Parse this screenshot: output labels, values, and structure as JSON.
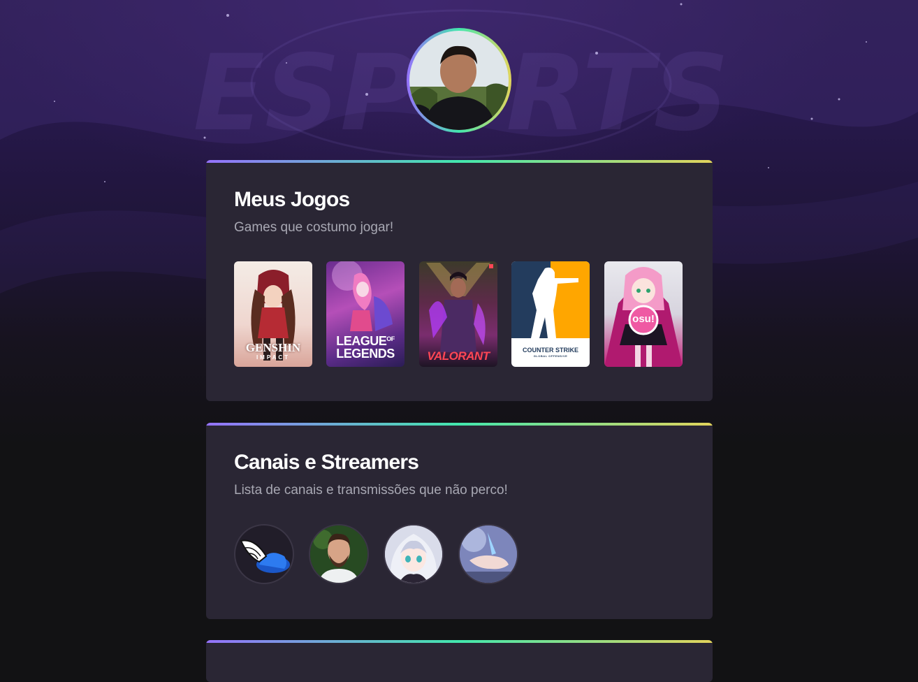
{
  "profile": {
    "avatar_icon": "user-photo",
    "ring_gradient": [
      "#9572fc",
      "#43e7ad",
      "#e2d45c"
    ]
  },
  "background": {
    "watermark_text": "ESPORTS"
  },
  "games_section": {
    "title": "Meus Jogos",
    "subtitle": "Games que costumo jogar!",
    "games": [
      {
        "name": "Genshin Impact",
        "logo_line1": "GENSHIN",
        "logo_line2": "IMPACT"
      },
      {
        "name": "League of Legends",
        "logo_line1": "LEAGUE",
        "logo_of": "OF",
        "logo_line2": "LEGENDS"
      },
      {
        "name": "Valorant",
        "logo_line1": "VALORANT"
      },
      {
        "name": "Counter-Strike",
        "logo_line1": "COUNTER",
        "logo_line2": "STRIKE",
        "logo_sub": "GLOBAL OFFENSIVE"
      },
      {
        "name": "osu!",
        "logo_line1": "osu!"
      }
    ]
  },
  "channels_section": {
    "title": "Canais e Streamers",
    "subtitle": "Lista de canais e transmissões que não perco!",
    "channels": [
      {
        "icon": "winged-cap-icon"
      },
      {
        "icon": "bearded-man-photo"
      },
      {
        "icon": "anime-girl-photo"
      },
      {
        "icon": "anime-hand-photo"
      }
    ]
  },
  "colors": {
    "card_bg": "#2a2634",
    "page_bg": "#121214",
    "title": "#ffffff",
    "subtitle": "#a8a8b3"
  }
}
